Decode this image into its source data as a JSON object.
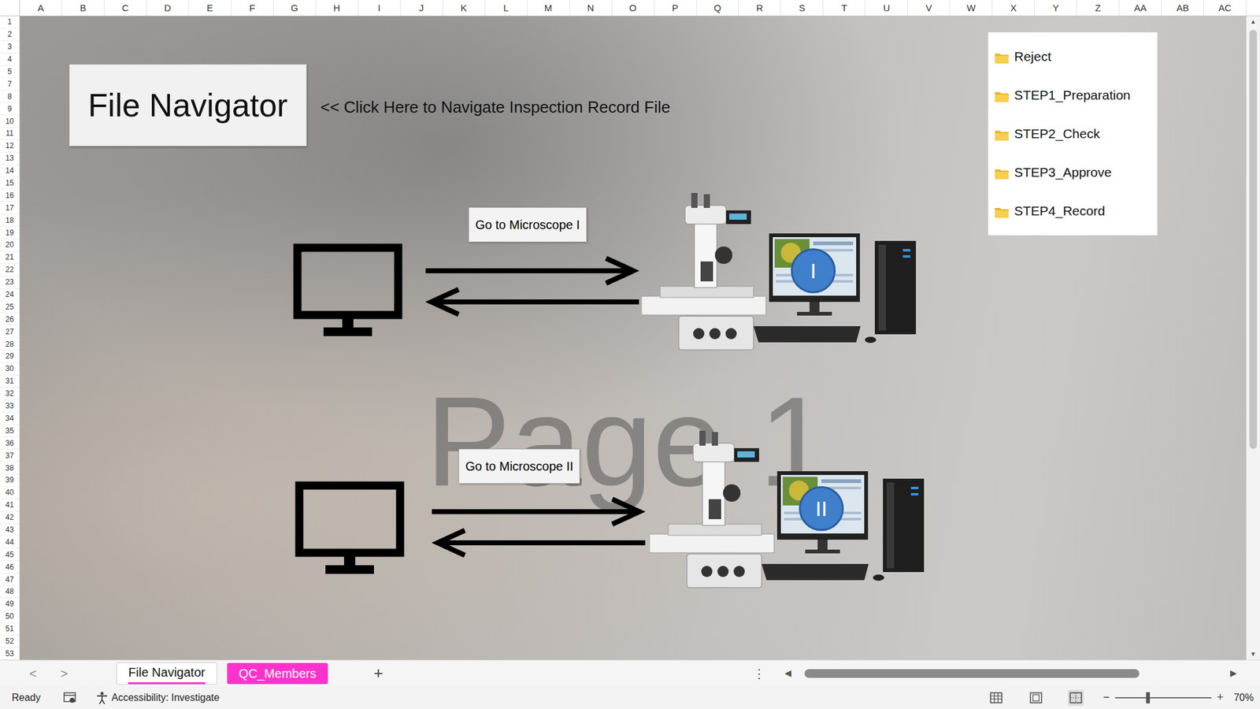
{
  "column_headers": [
    "A",
    "B",
    "C",
    "D",
    "E",
    "F",
    "G",
    "H",
    "I",
    "J",
    "K",
    "L",
    "M",
    "N",
    "O",
    "P",
    "Q",
    "R",
    "S",
    "T",
    "U",
    "V",
    "W",
    "X",
    "Y",
    "Z",
    "AA",
    "AB",
    "AC"
  ],
  "row_headers": [
    "1",
    "2",
    "3",
    "4",
    "5",
    "7",
    "8",
    "9",
    "10",
    "11",
    "12",
    "13",
    "14",
    "15",
    "16",
    "17",
    "18",
    "19",
    "20",
    "21",
    "22",
    "23",
    "24",
    "25",
    "26",
    "27",
    "28",
    "29",
    "30",
    "31",
    "32",
    "33",
    "34",
    "35",
    "36",
    "37",
    "38",
    "39",
    "40",
    "41",
    "42",
    "43",
    "44",
    "45",
    "46",
    "47",
    "48",
    "49",
    "50",
    "51",
    "52",
    "53"
  ],
  "navigator": {
    "button": "File Navigator",
    "hint": "<< Click Here to Navigate Inspection Record File"
  },
  "folders": [
    {
      "label": "Reject"
    },
    {
      "label": "STEP1_Preparation"
    },
    {
      "label": "STEP2_Check"
    },
    {
      "label": "STEP3_Approve"
    },
    {
      "label": "STEP4_Record"
    }
  ],
  "watermark": "Page 1",
  "stations": [
    {
      "button": "Go to Microscope I",
      "badge": "I"
    },
    {
      "button": "Go to Microscope II",
      "badge": "II"
    }
  ],
  "vertical_scroll": {
    "up": "▲",
    "down": "▼",
    "level": 0.68
  },
  "sheet_tabs": {
    "prev": "<",
    "next": ">",
    "tabs": [
      {
        "label": "File Navigator",
        "selected": true,
        "color": "#ff33cc"
      },
      {
        "label": "QC_Members",
        "selected": false,
        "color": "#ff33cc"
      }
    ],
    "add": "+",
    "more": "⋮"
  },
  "horizontal_scroll": {
    "left": "◀",
    "right": "▶",
    "level": 0.78
  },
  "status_bar": {
    "mode": "Ready",
    "accessibility": "Accessibility: Investigate",
    "views": [
      {
        "kind": "normal",
        "selected": false
      },
      {
        "kind": "layout",
        "selected": false
      },
      {
        "kind": "pagebreak",
        "selected": true
      }
    ],
    "zoom_out": "−",
    "zoom_in": "+",
    "zoom_level": 0.34,
    "zoom": "70%"
  }
}
